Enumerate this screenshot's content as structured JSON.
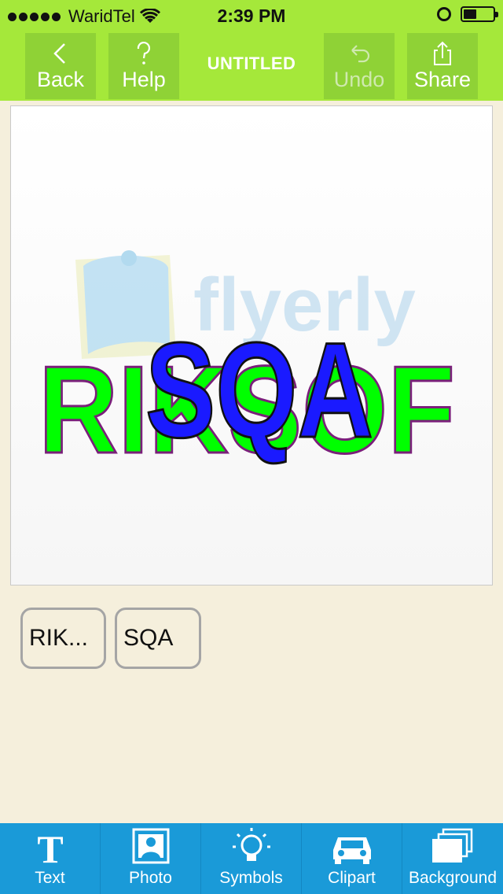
{
  "status_bar": {
    "carrier": "WaridTel",
    "time": "2:39 PM"
  },
  "nav": {
    "back_label": "Back",
    "help_label": "Help",
    "title": "UNTITLED",
    "undo_label": "Undo",
    "share_label": "Share"
  },
  "canvas": {
    "watermark_text": "flyerly",
    "layers_on_canvas": [
      {
        "text": "RIKSOF",
        "fill_color": "#00ff00",
        "stroke_color": "#7a1f7a"
      },
      {
        "text": "SQA",
        "fill_color": "#1a1aff",
        "stroke_color": "#111111"
      }
    ]
  },
  "layer_chips": [
    {
      "label": "RIK..."
    },
    {
      "label": "SQA"
    }
  ],
  "tabbar": {
    "items": [
      {
        "label": "Text",
        "icon": "text-T-icon"
      },
      {
        "label": "Photo",
        "icon": "photo-icon"
      },
      {
        "label": "Symbols",
        "icon": "lightbulb-icon"
      },
      {
        "label": "Clipart",
        "icon": "car-icon"
      },
      {
        "label": "Background",
        "icon": "layers-icon"
      }
    ]
  },
  "colors": {
    "top_green": "#a5e83a",
    "button_green": "#8fd236",
    "tab_blue": "#1a9ad8",
    "page_beige": "#f5efdc"
  }
}
